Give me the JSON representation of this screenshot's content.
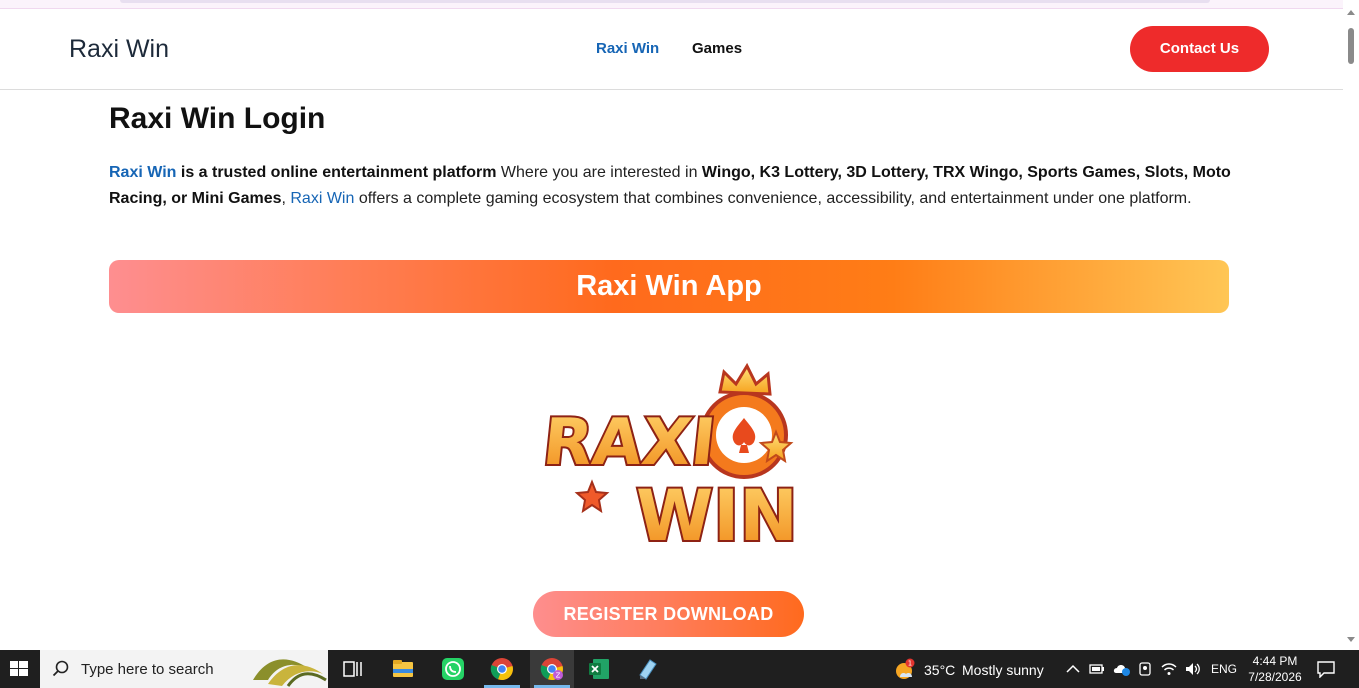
{
  "header": {
    "brand": "Raxi Win",
    "nav": [
      {
        "label": "Raxi Win",
        "active": true
      },
      {
        "label": "Games",
        "active": false
      }
    ],
    "contact_label": "Contact Us"
  },
  "main": {
    "title": "Raxi Win Login",
    "intro": {
      "p1_link": "Raxi Win",
      "p2_bold": " is a trusted online entertainment platform",
      "p3": " Where you are interested in ",
      "p4_bold": "Wingo, K3 Lottery, 3D Lottery, TRX Wingo, Sports Games, Slots, Moto Racing, or Mini Games",
      "p5": ", ",
      "p6_link": "Raxi Win",
      "p7": " offers a complete gaming ecosystem that combines convenience, accessibility, and entertainment under one platform."
    },
    "app_banner": "Raxi Win App",
    "logo": {
      "line1": "RAXI",
      "line2": "WIN"
    },
    "register_button": "REGISTER DOWNLOAD"
  },
  "taskbar": {
    "search_placeholder": "Type here to search",
    "weather_temp": "35°C",
    "weather_desc": "Mostly sunny",
    "language": "ENG",
    "time": "4:44 PM",
    "date": "7/28/2026",
    "weather_badge": "1",
    "chrome_profile_badge": "Z"
  },
  "colors": {
    "accent_link": "#1665b5",
    "contact_button": "#ee2b2b",
    "banner_start": "#fe8e90",
    "banner_end": "#ffc655"
  }
}
